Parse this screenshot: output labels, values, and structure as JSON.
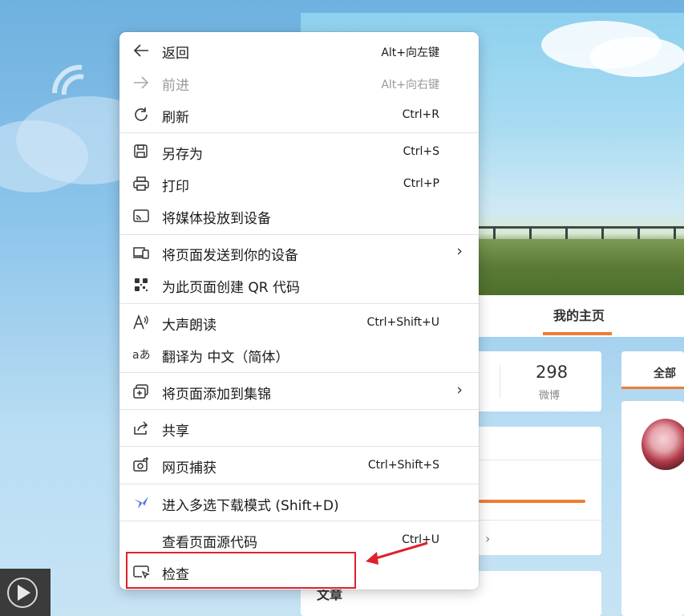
{
  "menu": {
    "items": [
      {
        "label": "返回",
        "shortcut": "Alt+向左键",
        "icon": "back-arrow-icon"
      },
      {
        "label": "前进",
        "shortcut": "Alt+向右键",
        "icon": "forward-arrow-icon",
        "disabled": true
      },
      {
        "label": "刷新",
        "shortcut": "Ctrl+R",
        "icon": "refresh-icon"
      },
      {
        "label": "另存为",
        "shortcut": "Ctrl+S",
        "icon": "save-icon"
      },
      {
        "label": "打印",
        "shortcut": "Ctrl+P",
        "icon": "print-icon"
      },
      {
        "label": "将媒体投放到设备",
        "shortcut": "",
        "icon": "cast-icon"
      },
      {
        "label": "将页面发送到你的设备",
        "shortcut": "",
        "icon": "send-to-device-icon",
        "submenu": true
      },
      {
        "label": "为此页面创建 QR 代码",
        "shortcut": "",
        "icon": "qr-code-icon"
      },
      {
        "label": "大声朗读",
        "shortcut": "Ctrl+Shift+U",
        "icon": "read-aloud-icon"
      },
      {
        "label": "翻译为 中文（简体）",
        "shortcut": "",
        "icon": "translate-icon"
      },
      {
        "label": "将页面添加到集锦",
        "shortcut": "",
        "icon": "collections-icon",
        "submenu": true
      },
      {
        "label": "共享",
        "shortcut": "",
        "icon": "share-icon"
      },
      {
        "label": "网页捕获",
        "shortcut": "Ctrl+Shift+S",
        "icon": "web-capture-icon"
      },
      {
        "label": "进入多选下载模式 (Shift+D)",
        "shortcut": "",
        "icon": "download-mode-icon"
      },
      {
        "label": "查看页面源代码",
        "shortcut": "Ctrl+U",
        "icon": ""
      },
      {
        "label": "检查",
        "shortcut": "",
        "icon": "inspect-icon"
      }
    ],
    "submenu_glyph": "›",
    "highlighted_item": "检查",
    "highlight_color": "#e0202a"
  },
  "page": {
    "tab_mine": "我的主页",
    "stat_value": "298",
    "stat_label": "微博",
    "all_tab": "全部",
    "section_title": "文章",
    "accent_color": "#ef7d33"
  }
}
